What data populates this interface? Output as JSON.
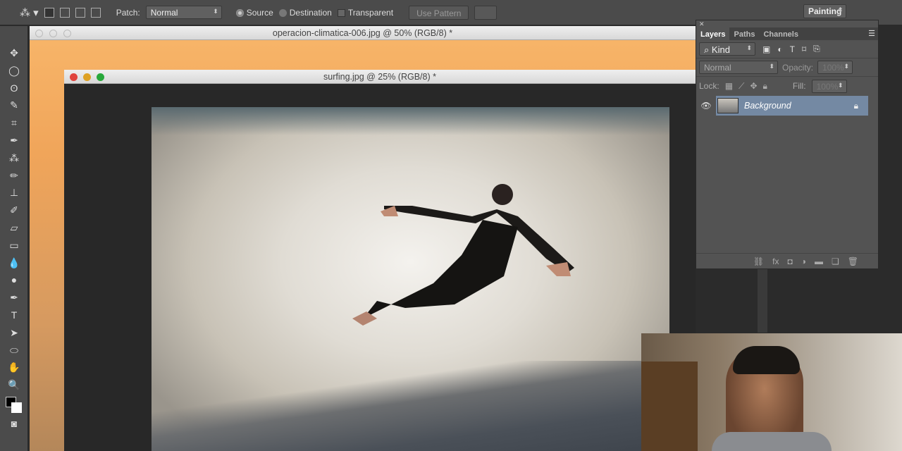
{
  "options_bar": {
    "patch_label": "Patch:",
    "patch_mode": "Normal",
    "source_label": "Source",
    "destination_label": "Destination",
    "transparent_label": "Transparent",
    "use_pattern_label": "Use Pattern",
    "workspace": "Painting",
    "source_selected": true
  },
  "documents": [
    {
      "title": "operacion-climatica-006.jpg @ 50% (RGB/8) *"
    },
    {
      "title": "surfing.jpg @ 25% (RGB/8) *"
    }
  ],
  "tools": [
    "move-icon",
    "marquee-icon",
    "lasso-icon",
    "quick-select-icon",
    "crop-icon",
    "eyedropper-icon",
    "patch-icon",
    "brush-icon",
    "stamp-icon",
    "history-brush-icon",
    "eraser-icon",
    "gradient-icon",
    "blur-icon",
    "dodge-icon",
    "pen-icon",
    "type-icon",
    "path-select-icon",
    "ellipse-icon",
    "hand-icon",
    "zoom-icon"
  ],
  "tool_glyphs": [
    "✥",
    "◯",
    "ʘ",
    "✎",
    "⌗",
    "✒",
    "⁂",
    "✏",
    "⊥",
    "✐",
    "▱",
    "▭",
    "💧",
    "●",
    "✒",
    "T",
    "➤",
    "⬭",
    "✋",
    "🔍"
  ],
  "layers_panel": {
    "tabs": [
      "Layers",
      "Paths",
      "Channels"
    ],
    "filter": "Kind",
    "blend_mode": "Normal",
    "opacity_label": "Opacity:",
    "opacity": "100%",
    "lock_label": "Lock:",
    "fill_label": "Fill:",
    "fill": "100%",
    "layers": [
      {
        "name": "Background",
        "visible": true,
        "locked": true
      }
    ]
  }
}
